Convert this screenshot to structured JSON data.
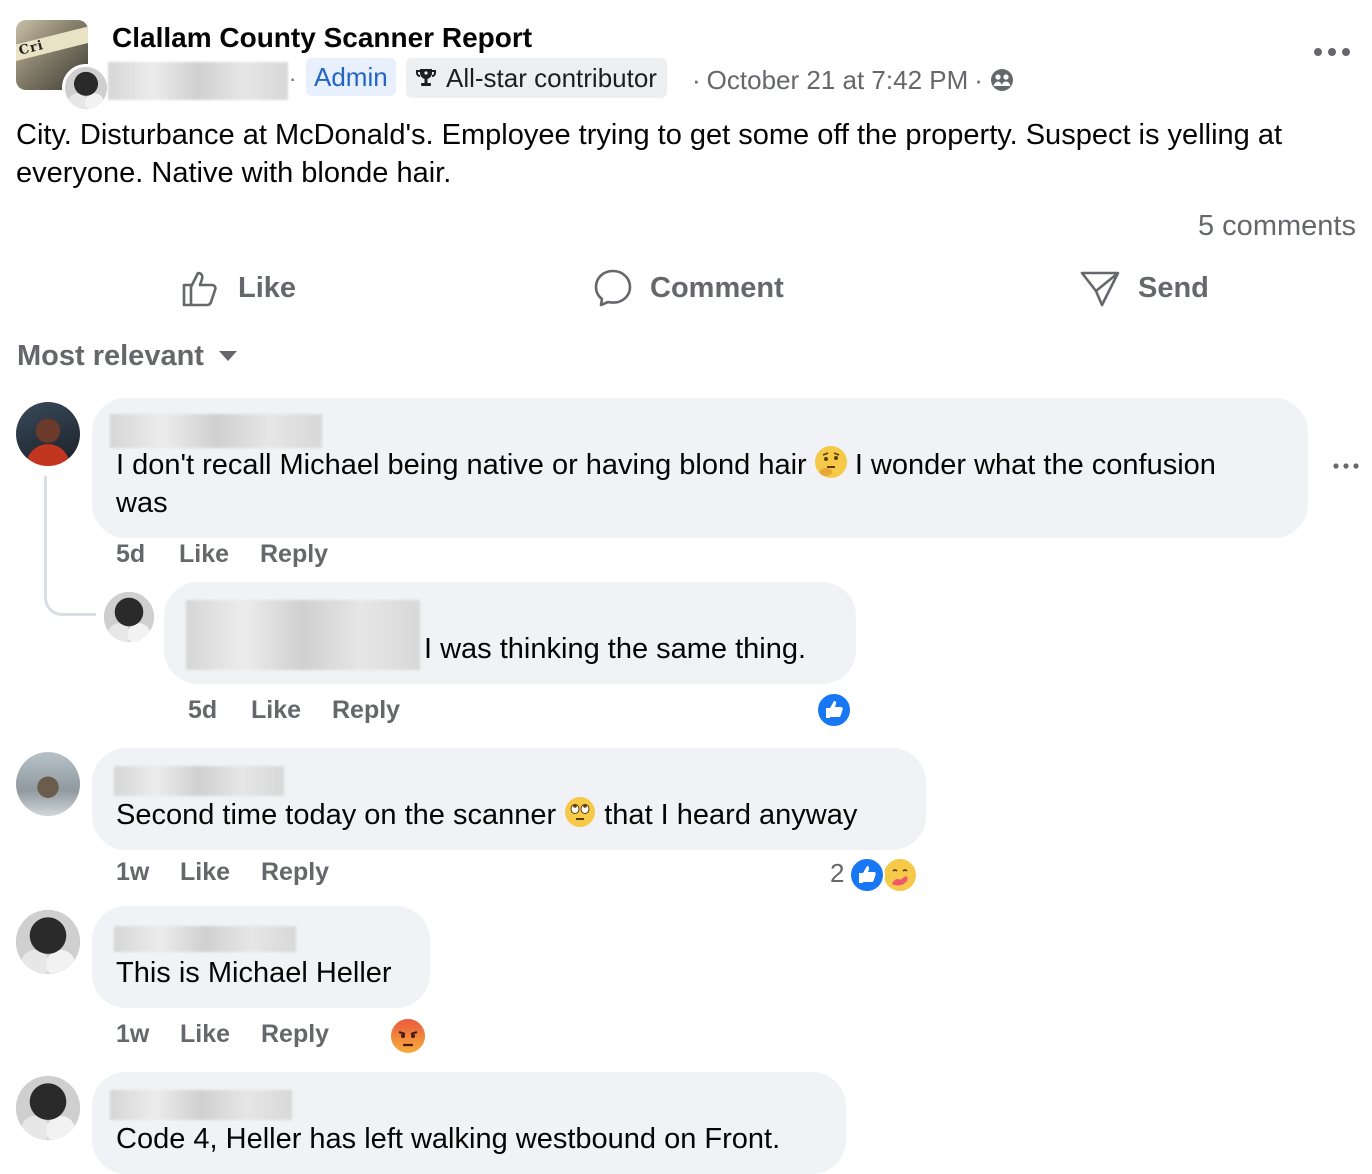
{
  "post": {
    "group_name": "Clallam County Scanner Report",
    "group_avatar_text": "Cri",
    "author_role": "Admin",
    "badge": "All-star contributor",
    "timestamp": "October 21 at 7:42 PM",
    "separator": "·",
    "privacy_icon": "group-audience-icon",
    "body": "City. Disturbance at McDonald's.  Employee trying to get some off the property.  Suspect is yelling at everyone.  Native with blonde hair.",
    "comment_count": "5 comments"
  },
  "actions": {
    "like": "Like",
    "comment": "Comment",
    "send": "Send"
  },
  "sort": {
    "label": "Most relevant"
  },
  "comments": [
    {
      "text_before": "I don't recall Michael being native or having blond hair",
      "emoji": "thinking-face",
      "text_after": "I wonder what the confusion was",
      "age": "5d",
      "like": "Like",
      "reply": "Reply",
      "reply_item": {
        "text": "I was thinking the same thing.",
        "age": "5d",
        "like": "Like",
        "reply": "Reply",
        "reactions": [
          "like"
        ]
      }
    },
    {
      "text_before": "Second time today on the scanner",
      "emoji": "eye-roll-face",
      "text_after": "that I heard anyway",
      "age": "1w",
      "like": "Like",
      "reply": "Reply",
      "reaction_count": "2",
      "reactions": [
        "like",
        "care"
      ]
    },
    {
      "text": "This is Michael Heller",
      "age": "1w",
      "like": "Like",
      "reply": "Reply",
      "reactions": [
        "angry"
      ]
    },
    {
      "text": "Code 4, Heller has left walking westbound on Front."
    }
  ],
  "colors": {
    "link_blue": "#2465c4",
    "muted": "#65676b",
    "bubble": "#f0f2f5",
    "like_blue": "#1877f2"
  }
}
